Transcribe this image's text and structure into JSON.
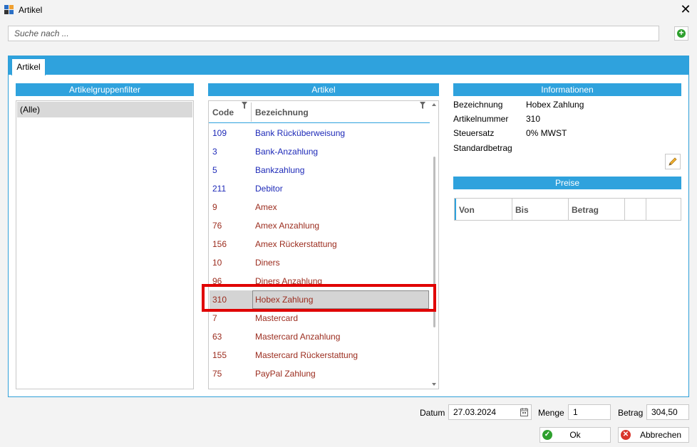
{
  "window": {
    "title": "Artikel",
    "close_glyph": "✕"
  },
  "search": {
    "placeholder": "Suche nach ...",
    "value": ""
  },
  "tabs": [
    {
      "label": "Artikel"
    }
  ],
  "groups": {
    "header": "Artikelgruppenfilter",
    "items": [
      "(Alle)"
    ]
  },
  "articles": {
    "header": "Artikel",
    "columns": {
      "code": "Code",
      "name": "Bezeichnung"
    },
    "rows": [
      {
        "code": "109",
        "name": "Bank Rücküberweisung",
        "color": "blue"
      },
      {
        "code": "3",
        "name": "Bank-Anzahlung",
        "color": "blue"
      },
      {
        "code": "5",
        "name": "Bankzahlung",
        "color": "blue"
      },
      {
        "code": "211",
        "name": "Debitor",
        "color": "blue"
      },
      {
        "code": "9",
        "name": "Amex",
        "color": "red"
      },
      {
        "code": "76",
        "name": "Amex Anzahlung",
        "color": "red"
      },
      {
        "code": "156",
        "name": "Amex Rückerstattung",
        "color": "red"
      },
      {
        "code": "10",
        "name": "Diners",
        "color": "red"
      },
      {
        "code": "96",
        "name": "Diners Anzahlung",
        "color": "red"
      },
      {
        "code": "310",
        "name": "Hobex Zahlung",
        "color": "red",
        "selected": true
      },
      {
        "code": "7",
        "name": "Mastercard",
        "color": "red"
      },
      {
        "code": "63",
        "name": "Mastercard Anzahlung",
        "color": "red"
      },
      {
        "code": "155",
        "name": "Mastercard Rückerstattung",
        "color": "red"
      },
      {
        "code": "75",
        "name": "PayPal Zahlung",
        "color": "red"
      }
    ]
  },
  "info": {
    "header": "Informationen",
    "fields": [
      {
        "label": "Bezeichnung",
        "value": "Hobex Zahlung"
      },
      {
        "label": "Artikelnummer",
        "value": "310"
      },
      {
        "label": "Steuersatz",
        "value": "0% MWST"
      },
      {
        "label": "Standardbetrag",
        "value": ""
      }
    ]
  },
  "prices": {
    "header": "Preise",
    "columns": [
      "Von",
      "Bis",
      "Betrag",
      "",
      ""
    ]
  },
  "footer": {
    "datum_label": "Datum",
    "datum_value": "27.03.2024",
    "menge_label": "Menge",
    "menge_value": "1",
    "betrag_label": "Betrag",
    "betrag_value": "304,50",
    "ok_label": "Ok",
    "cancel_label": "Abbrechen"
  },
  "colors": {
    "accent": "#2fa2dd",
    "highlight": "#e00000",
    "blue_text": "#1e2ab8",
    "red_text": "#9b2c1e"
  }
}
